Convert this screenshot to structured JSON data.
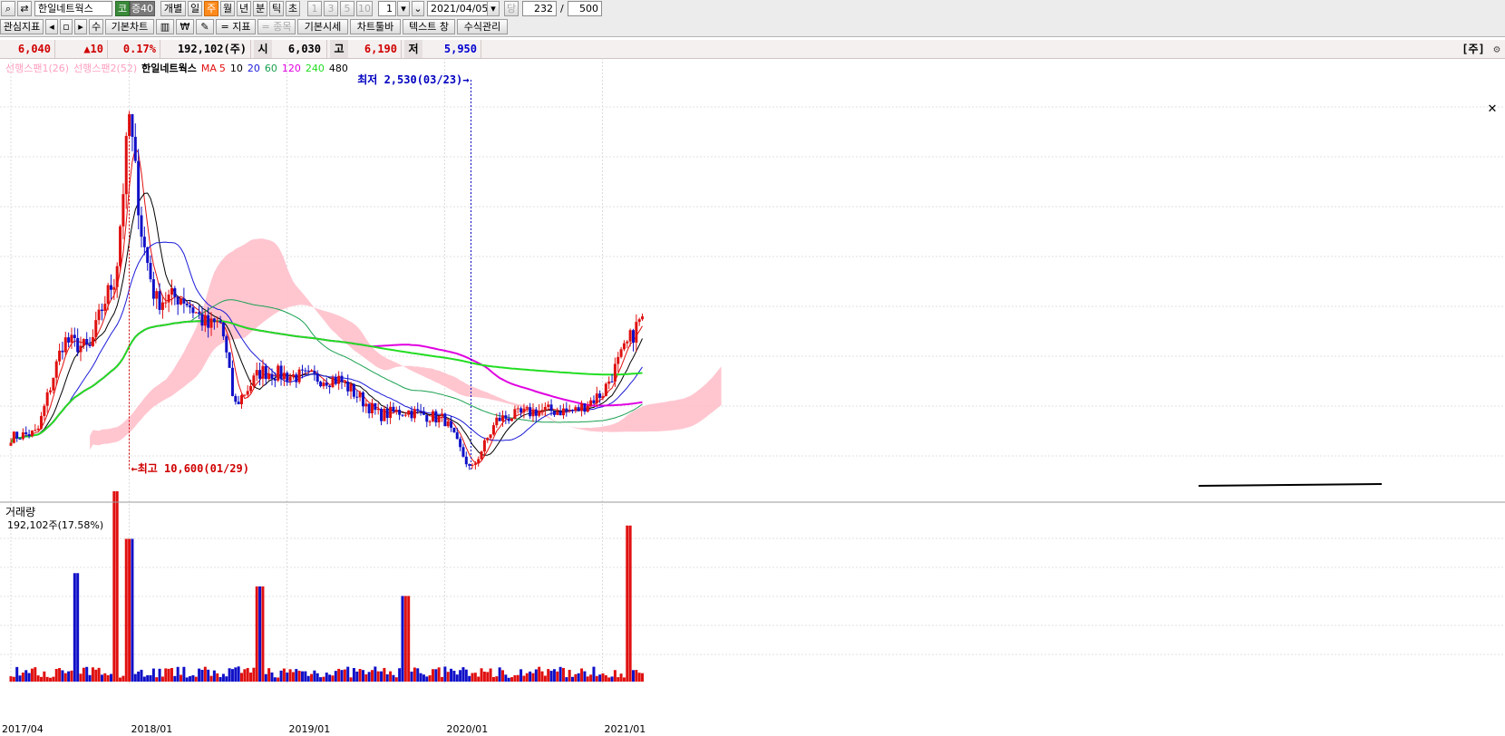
{
  "toolbar": {
    "stock_name": "한일네트웍스",
    "market_badge": "코",
    "margin_badge": "증40",
    "period_buttons": [
      "개별",
      "일",
      "주",
      "월",
      "년",
      "분",
      "틱",
      "초"
    ],
    "selected_period": "주",
    "interval_buttons": [
      "1",
      "3",
      "5",
      "10"
    ],
    "interval_value": "1",
    "date": "2021/04/05",
    "count_label": "당",
    "count_value": "232",
    "count_sep": "/",
    "count_total": "500",
    "row2_buttons": [
      "관심지표",
      "◂",
      "▫",
      "▸",
      "수",
      "기본차트",
      "지표",
      "종목",
      "기본시세",
      "차트툴바",
      "텍스트 창",
      "수식관리"
    ]
  },
  "quote": {
    "price": "6,040",
    "change": "▲10",
    "change_pct": "0.17%",
    "volume": "192,102(주)",
    "open_label": "시",
    "open": "6,030",
    "high_label": "고",
    "high": "6,190",
    "low_label": "저",
    "low": "5,950",
    "unit_badge": "[주]",
    "settings_icon": "gear-icon"
  },
  "legend": {
    "span1": "선행스팬1(26)",
    "span2": "선행스팬2(52)",
    "stock": "한일네트웍스",
    "ma_label": "MA",
    "ma": [
      {
        "label": "5",
        "color": "#e01010"
      },
      {
        "label": "10",
        "color": "#000000"
      },
      {
        "label": "20",
        "color": "#1a1ad8"
      },
      {
        "label": "60",
        "color": "#1aa050"
      },
      {
        "label": "120",
        "color": "#e000e0"
      },
      {
        "label": "240",
        "color": "#22dd22"
      },
      {
        "label": "480",
        "color": "#000000"
      }
    ]
  },
  "annotations": {
    "high": "최고 10,600(01/29)",
    "low": "최저 2,530(03/23)"
  },
  "volume_panel": {
    "title": "거래량",
    "value": "192,102주(17.58%)"
  },
  "colors": {
    "up": "#e01010",
    "down": "#1010c8",
    "cloud": "#ffc0cb",
    "accent": "#ff8a1c"
  },
  "chart_data": {
    "type": "candlestick",
    "x_ticks": [
      "2017/04",
      "2018/01",
      "2019/01",
      "2020/01",
      "2021/01"
    ],
    "price_range": [
      2400,
      11000
    ],
    "price_anchors": [
      {
        "date": "2017/04",
        "price": 3300
      },
      {
        "date": "2017/06",
        "price": 3400
      },
      {
        "date": "2017/08",
        "price": 5500
      },
      {
        "date": "2017/10",
        "price": 5300
      },
      {
        "date": "2017/11",
        "price": 6300
      },
      {
        "date": "2017/12",
        "price": 7000
      },
      {
        "date": "2018/01",
        "price": 10600
      },
      {
        "date": "2018/02",
        "price": 7800
      },
      {
        "date": "2018/03",
        "price": 6400
      },
      {
        "date": "2018/05",
        "price": 6500
      },
      {
        "date": "2018/07",
        "price": 5800
      },
      {
        "date": "2018/08",
        "price": 5900
      },
      {
        "date": "2018/09",
        "price": 4000
      },
      {
        "date": "2018/11",
        "price": 4800
      },
      {
        "date": "2019/01",
        "price": 4700
      },
      {
        "date": "2019/05",
        "price": 4600
      },
      {
        "date": "2019/08",
        "price": 3800
      },
      {
        "date": "2019/10",
        "price": 3900
      },
      {
        "date": "2020/01",
        "price": 3700
      },
      {
        "date": "2020/03",
        "price": 2530
      },
      {
        "date": "2020/05",
        "price": 3700
      },
      {
        "date": "2020/08",
        "price": 3900
      },
      {
        "date": "2020/11",
        "price": 3900
      },
      {
        "date": "2021/01",
        "price": 4300
      },
      {
        "date": "2021/04",
        "price": 6040
      }
    ],
    "volume_spikes": [
      {
        "date": "2017/12",
        "volume_ratio": 1.0
      },
      {
        "date": "2018/01",
        "volume_ratio": 0.75
      },
      {
        "date": "2017/09",
        "volume_ratio": 0.57
      },
      {
        "date": "2018/11",
        "volume_ratio": 0.5
      },
      {
        "date": "2019/10",
        "volume_ratio": 0.45
      },
      {
        "date": "2021/03",
        "volume_ratio": 0.82
      }
    ]
  }
}
